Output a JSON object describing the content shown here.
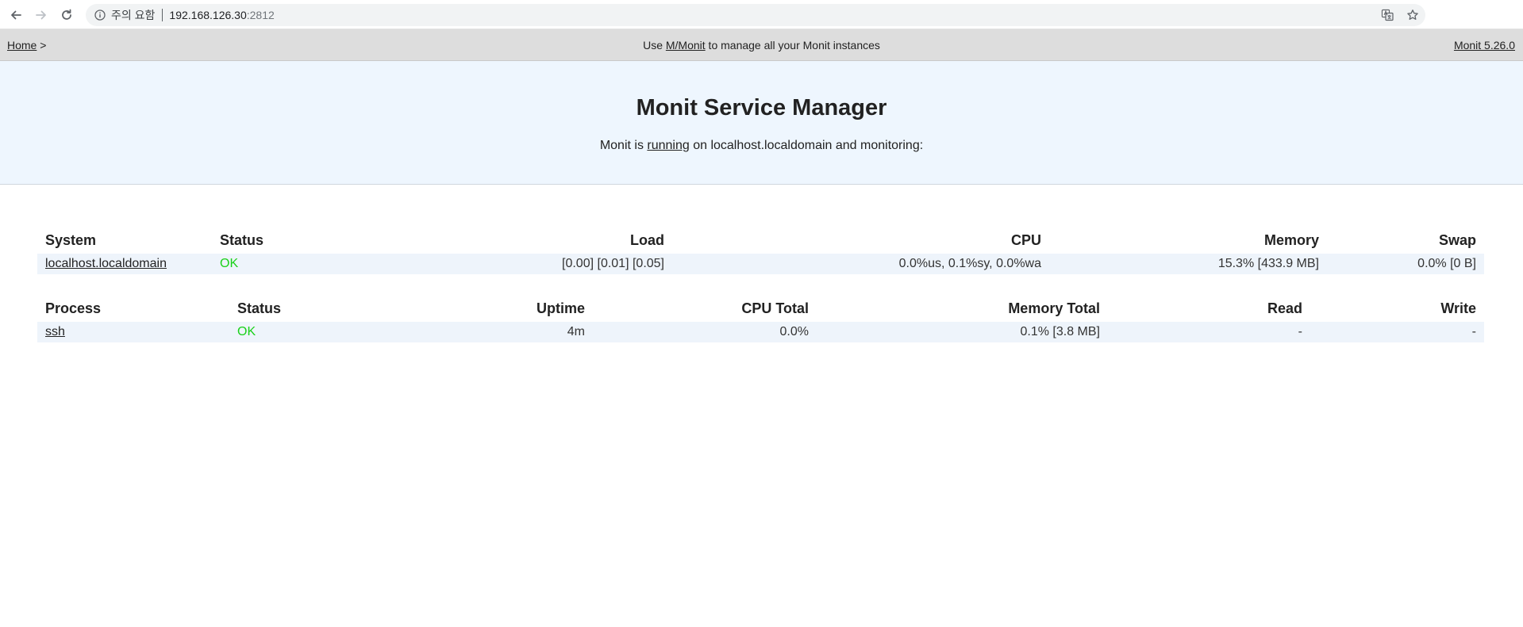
{
  "browser": {
    "security_warning": "주의 요함",
    "url_host": "192.168.126.30",
    "url_port": ":2812",
    "icons": {
      "back": "arrow-left-icon",
      "forward": "arrow-right-icon",
      "reload": "reload-icon",
      "info": "info-icon",
      "translate": "translate-icon",
      "bookmark": "star-icon"
    }
  },
  "topbar": {
    "home_link": "Home",
    "crumb_sep": " >",
    "msg_prefix": "Use ",
    "mmonit_link": "M/Monit",
    "msg_suffix": " to manage all your Monit instances",
    "version_link": "Monit 5.26.0"
  },
  "hero": {
    "title": "Monit Service Manager",
    "sub_prefix": "Monit is ",
    "running_link": "running",
    "sub_suffix": " on localhost.localdomain and monitoring:"
  },
  "system_table": {
    "headers": {
      "system": "System",
      "status": "Status",
      "load": "Load",
      "cpu": "CPU",
      "memory": "Memory",
      "swap": "Swap"
    },
    "rows": [
      {
        "name": "localhost.localdomain",
        "status": "OK",
        "load": "[0.00] [0.01] [0.05]",
        "cpu": "0.0%us, 0.1%sy, 0.0%wa",
        "memory": "15.3% [433.9 MB]",
        "swap": "0.0% [0 B]"
      }
    ]
  },
  "process_table": {
    "headers": {
      "process": "Process",
      "status": "Status",
      "uptime": "Uptime",
      "cpu_total": "CPU Total",
      "memory_total": "Memory Total",
      "read": "Read",
      "write": "Write"
    },
    "rows": [
      {
        "name": "ssh",
        "status": "OK",
        "uptime": "4m",
        "cpu_total": "0.0%",
        "memory_total": "0.1% [3.8 MB]",
        "read": "-",
        "write": "-"
      }
    ]
  },
  "colors": {
    "status_ok": "#19d119",
    "topbar_bg": "#dddddd",
    "hero_bg": "#eef6fe",
    "row_bg": "#eef4fb"
  }
}
